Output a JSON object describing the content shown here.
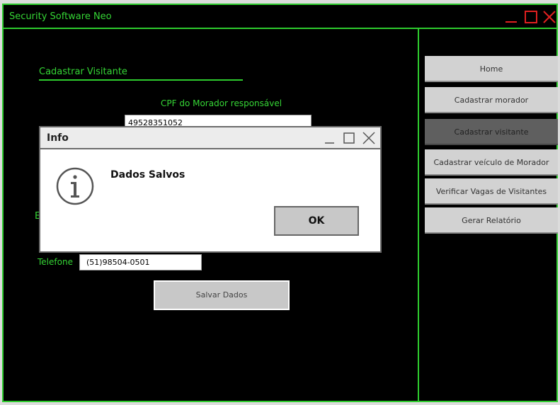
{
  "window": {
    "title": "Security Software Neo",
    "accent_color": "#2ecc2e",
    "close_color": "#e02020",
    "controls": [
      "minimize-icon",
      "maximize-icon",
      "close-icon"
    ]
  },
  "form": {
    "section_title": "Cadastrar Visitante",
    "cpf_label": "CPF do Morador responsável",
    "cpf_value": "49528351052",
    "partial_label": "E",
    "phone_label": "Telefone",
    "phone_value": "(51)98504-0501",
    "save_label": "Salvar Dados"
  },
  "sidebar": {
    "items": [
      {
        "label": "Home",
        "active": false
      },
      {
        "label": "Cadastrar morador",
        "active": false
      },
      {
        "label": "Cadastrar visitante",
        "active": true
      },
      {
        "label": "Cadastrar veículo de Morador",
        "active": false
      },
      {
        "label": "Verificar Vagas de Visitantes",
        "active": false
      },
      {
        "label": "Gerar Relatório",
        "active": false
      }
    ]
  },
  "dialog": {
    "title": "Info",
    "message": "Dados Salvos",
    "ok_label": "OK",
    "icon": "info-icon"
  }
}
